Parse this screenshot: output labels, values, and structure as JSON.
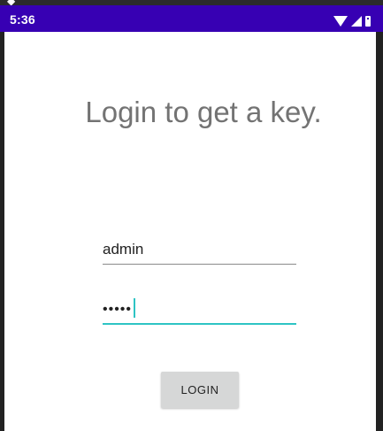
{
  "status_bar": {
    "time": "5:36",
    "icons": [
      "wifi-icon",
      "signal-icon",
      "battery-icon"
    ],
    "color": "#3700b3"
  },
  "main": {
    "title": "Login to get a key.",
    "username": {
      "value": "admin"
    },
    "password": {
      "masked_value": "•••••",
      "focused": true
    },
    "login_button": {
      "label": "LOGIN"
    }
  },
  "colors": {
    "accent": "#2ec4c4",
    "title_text": "#737373",
    "button_bg": "#d6d7d7"
  }
}
